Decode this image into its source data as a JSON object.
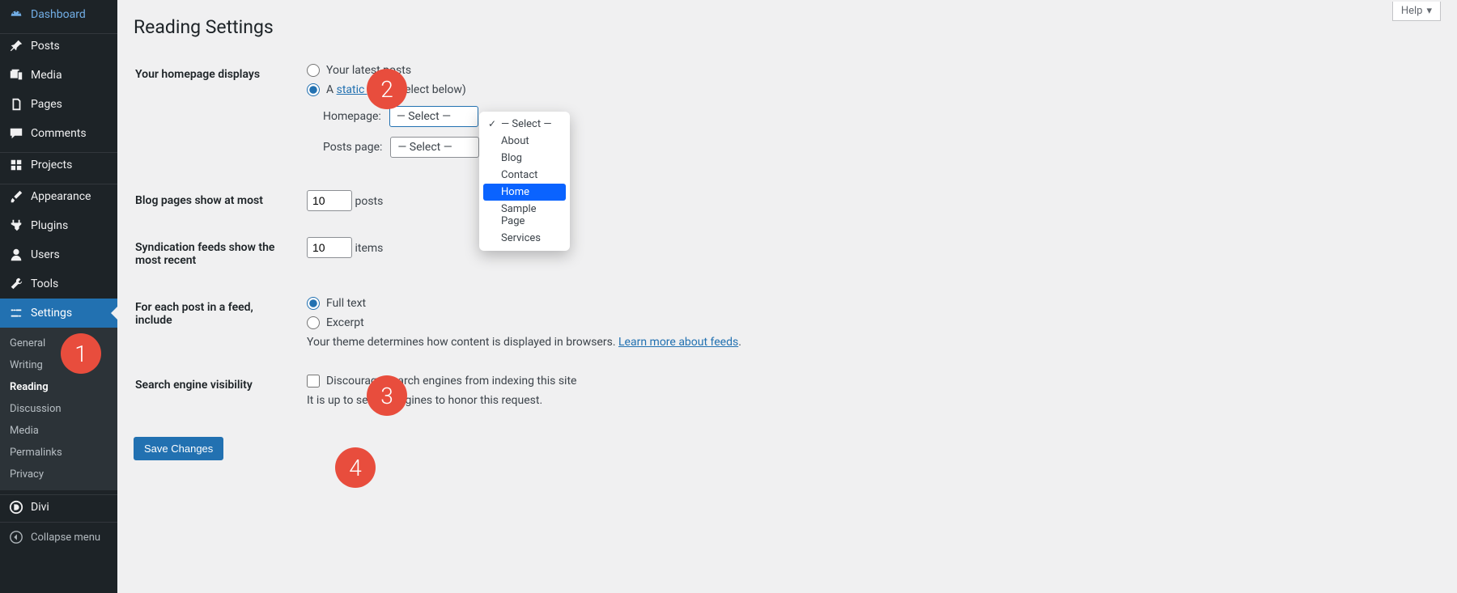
{
  "sidebar": {
    "items": [
      {
        "label": "Dashboard"
      },
      {
        "label": "Posts"
      },
      {
        "label": "Media"
      },
      {
        "label": "Pages"
      },
      {
        "label": "Comments"
      },
      {
        "label": "Projects"
      },
      {
        "label": "Appearance"
      },
      {
        "label": "Plugins"
      },
      {
        "label": "Users"
      },
      {
        "label": "Tools"
      },
      {
        "label": "Settings"
      },
      {
        "label": "Divi"
      }
    ],
    "submenu": [
      {
        "label": "General"
      },
      {
        "label": "Writing"
      },
      {
        "label": "Reading"
      },
      {
        "label": "Discussion"
      },
      {
        "label": "Media"
      },
      {
        "label": "Permalinks"
      },
      {
        "label": "Privacy"
      }
    ],
    "collapse": "Collapse menu"
  },
  "help": "Help",
  "page_title": "Reading Settings",
  "homepage": {
    "heading": "Your homepage displays",
    "opt_latest": "Your latest posts",
    "opt_static_prefix": "A",
    "opt_static_link": "static page",
    "opt_static_suffix": "(select below)",
    "homepage_label": "Homepage:",
    "posts_page_label": "Posts page:",
    "select_placeholder": "— Select —"
  },
  "blog_pages": {
    "heading": "Blog pages show at most",
    "value": "10",
    "unit": "posts"
  },
  "syndication": {
    "heading": "Syndication feeds show the most recent",
    "value": "10",
    "unit": "items"
  },
  "feed_post": {
    "heading": "For each post in a feed, include",
    "opt_full": "Full text",
    "opt_excerpt": "Excerpt",
    "desc_prefix": "Your theme determines how content is displayed in browsers.",
    "desc_link": "Learn more about feeds",
    "desc_suffix": "."
  },
  "search": {
    "heading": "Search engine visibility",
    "checkbox": "Discourage search engines from indexing this site",
    "desc": "It is up to search engines to honor this request."
  },
  "save": "Save Changes",
  "dropdown": {
    "items": [
      {
        "label": "— Select —"
      },
      {
        "label": "About"
      },
      {
        "label": "Blog"
      },
      {
        "label": "Contact"
      },
      {
        "label": "Home"
      },
      {
        "label": "Sample Page"
      },
      {
        "label": "Services"
      }
    ]
  },
  "badges": {
    "b1": "1",
    "b2": "2",
    "b3": "3",
    "b4": "4"
  }
}
